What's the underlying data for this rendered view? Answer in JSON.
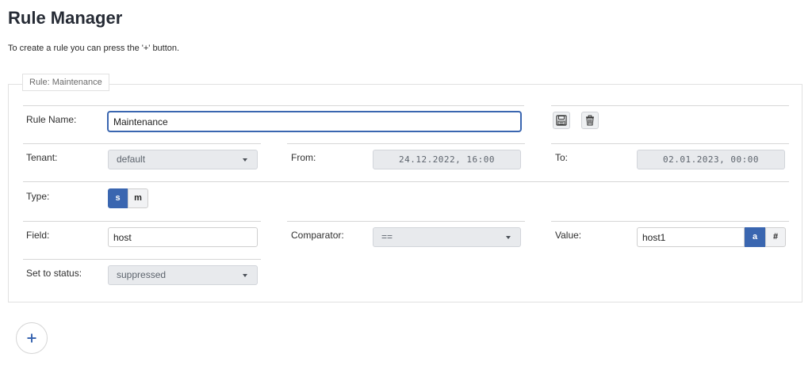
{
  "header": {
    "title": "Rule Manager",
    "subtitle": "To create a rule you can press the '+' button."
  },
  "rule": {
    "legend": "Rule: Maintenance",
    "name_label": "Rule Name:",
    "name_value": "Maintenance",
    "tenant_label": "Tenant:",
    "tenant_value": "default",
    "from_label": "From:",
    "from_value": "24.12.2022, 16:00",
    "to_label": "To:",
    "to_value": "02.01.2023, 00:00",
    "type_label": "Type:",
    "type_options": [
      "s",
      "m"
    ],
    "type_selected": "s",
    "field_label": "Field:",
    "field_value": "host",
    "comparator_label": "Comparator:",
    "comparator_value": "==",
    "value_label": "Value:",
    "value_value": "host1",
    "value_mode_options": [
      "a",
      "#"
    ],
    "value_mode_selected": "a",
    "status_label": "Set to status:",
    "status_value": "suppressed"
  },
  "actions": {
    "save_icon": "floppy-disk-icon",
    "delete_icon": "trash-icon",
    "add_label": "+"
  },
  "colors": {
    "accent": "#3a66b0",
    "disabled_bg": "#e8eaed"
  }
}
